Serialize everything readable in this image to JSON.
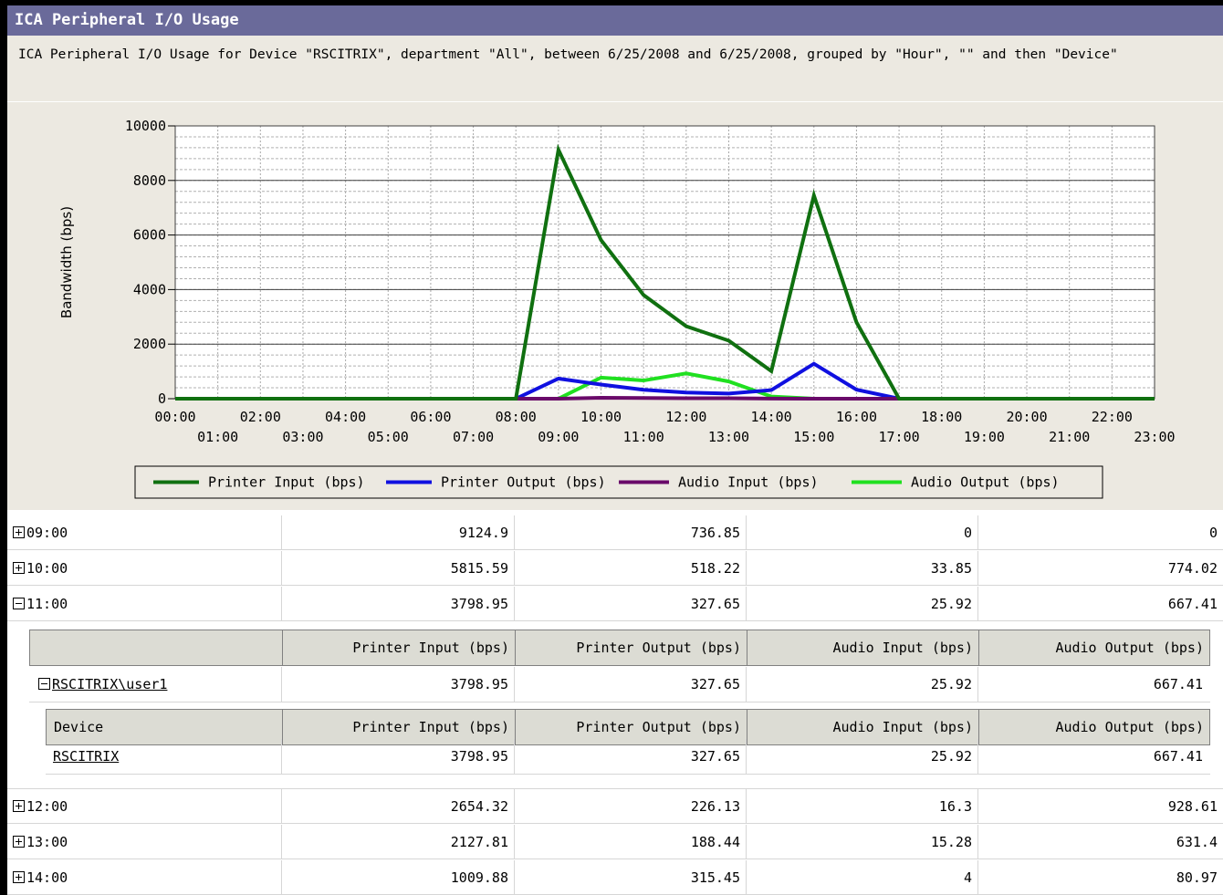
{
  "window": {
    "title": "ICA Peripheral I/O Usage",
    "subtitle": "ICA Peripheral I/O Usage for Device \"RSCITRIX\", department \"All\", between 6/25/2008 and 6/25/2008, grouped by \"Hour\", \"\" and then \"Device\""
  },
  "chart_data": {
    "type": "line",
    "ylabel": "Bandwidth (bps)",
    "xlabel": "",
    "ylim": [
      0,
      10000
    ],
    "yticks": [
      "0",
      "2000",
      "4000",
      "6000",
      "8000",
      "10000"
    ],
    "categories": [
      "00:00",
      "01:00",
      "02:00",
      "03:00",
      "04:00",
      "05:00",
      "06:00",
      "07:00",
      "08:00",
      "09:00",
      "10:00",
      "11:00",
      "12:00",
      "13:00",
      "14:00",
      "15:00",
      "16:00",
      "17:00",
      "18:00",
      "19:00",
      "20:00",
      "21:00",
      "22:00",
      "23:00"
    ],
    "series": [
      {
        "name": "Printer Input (bps)",
        "color": "#107010",
        "values": [
          0,
          0,
          0,
          0,
          0,
          0,
          0,
          0,
          0,
          9124.9,
          5815.59,
          3798.95,
          2654.32,
          2127.81,
          1009.88,
          7450,
          2800,
          0,
          0,
          0,
          0,
          0,
          0,
          0
        ]
      },
      {
        "name": "Printer Output (bps)",
        "color": "#1010e0",
        "values": [
          0,
          0,
          0,
          0,
          0,
          0,
          0,
          0,
          0,
          736.85,
          518.22,
          327.65,
          226.13,
          188.44,
          315.45,
          1280,
          330,
          0,
          0,
          0,
          0,
          0,
          0,
          0
        ]
      },
      {
        "name": "Audio Input (bps)",
        "color": "#6a0a6a",
        "values": [
          0,
          0,
          0,
          0,
          0,
          0,
          0,
          0,
          0,
          0,
          33.85,
          25.92,
          16.3,
          15.28,
          4,
          0,
          0,
          0,
          0,
          0,
          0,
          0,
          0,
          0
        ]
      },
      {
        "name": "Audio Output (bps)",
        "color": "#20e020",
        "values": [
          0,
          0,
          0,
          0,
          0,
          0,
          0,
          0,
          0,
          0,
          774.02,
          667.41,
          928.61,
          631.4,
          80.97,
          0,
          0,
          0,
          0,
          0,
          0,
          0,
          0,
          0
        ]
      }
    ],
    "grid": true,
    "legend": "bottom"
  },
  "table": {
    "rows": [
      {
        "label": "09:00",
        "expanded": false,
        "values": [
          "9124.9",
          "736.85",
          "0",
          "0"
        ]
      },
      {
        "label": "10:00",
        "expanded": false,
        "values": [
          "5815.59",
          "518.22",
          "33.85",
          "774.02"
        ]
      },
      {
        "label": "11:00",
        "expanded": true,
        "values": [
          "3798.95",
          "327.65",
          "25.92",
          "667.41"
        ]
      }
    ],
    "user_headers": [
      "",
      "Printer Input (bps)",
      "Printer Output (bps)",
      "Audio Input (bps)",
      "Audio Output (bps)"
    ],
    "user_row": {
      "label": "RSCITRIX\\user1",
      "values": [
        "3798.95",
        "327.65",
        "25.92",
        "667.41"
      ]
    },
    "device_headers": [
      "Device",
      "Printer Input (bps)",
      "Printer Output (bps)",
      "Audio Input (bps)",
      "Audio Output (bps)"
    ],
    "device_row": {
      "label": "RSCITRIX",
      "values": [
        "3798.95",
        "327.65",
        "25.92",
        "667.41"
      ]
    },
    "rows_after": [
      {
        "label": "12:00",
        "expanded": false,
        "values": [
          "2654.32",
          "226.13",
          "16.3",
          "928.61"
        ]
      },
      {
        "label": "13:00",
        "expanded": false,
        "values": [
          "2127.81",
          "188.44",
          "15.28",
          "631.4"
        ]
      },
      {
        "label": "14:00",
        "expanded": false,
        "values": [
          "1009.88",
          "315.45",
          "4",
          "80.97"
        ]
      }
    ]
  }
}
